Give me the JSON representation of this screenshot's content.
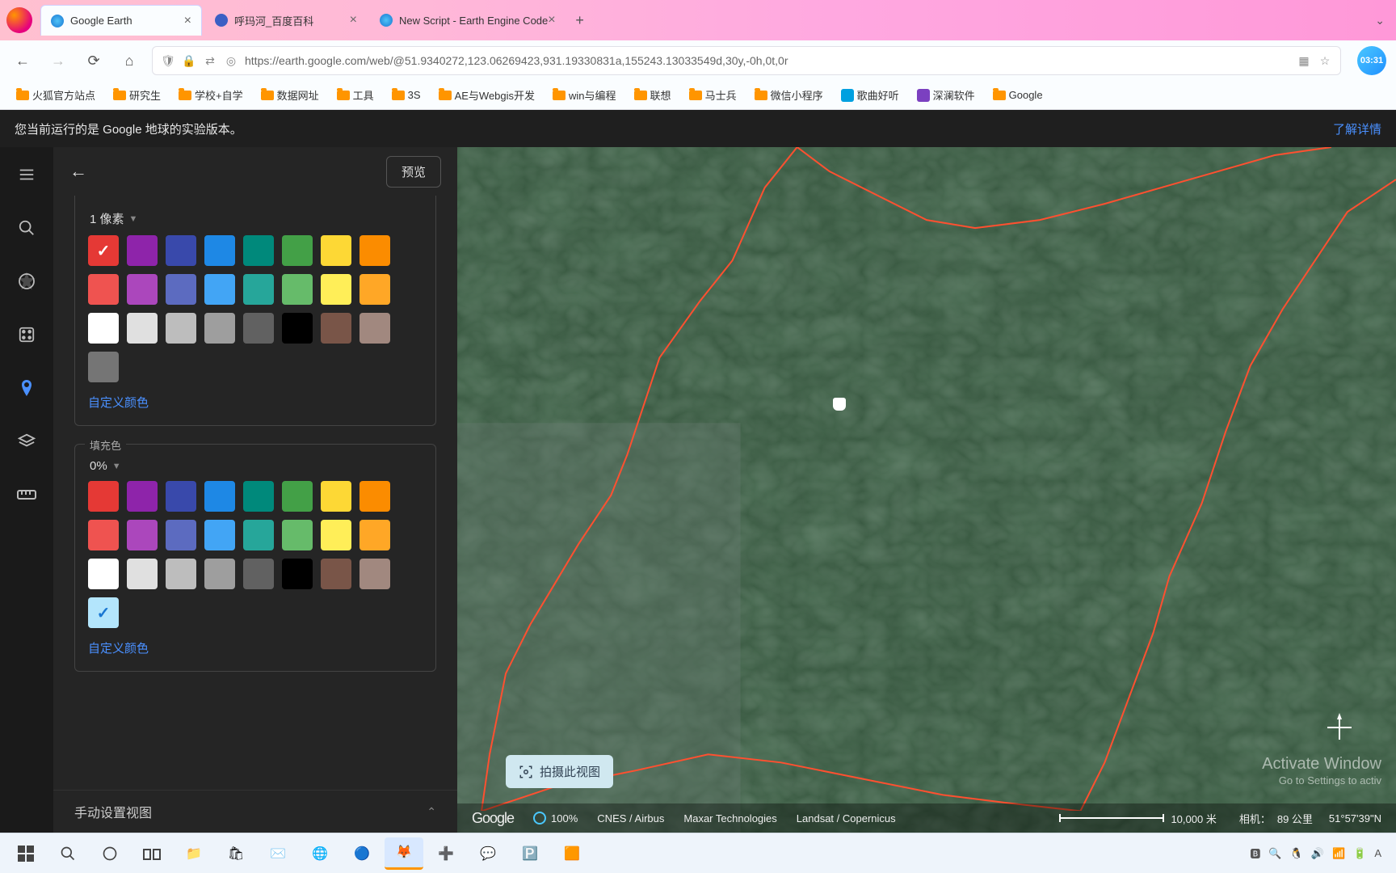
{
  "browser": {
    "tabs": [
      {
        "title": "Google Earth",
        "favicon": "#4285f4",
        "active": true
      },
      {
        "title": "呼玛河_百度百科",
        "favicon": "#3b5fc4",
        "active": false
      },
      {
        "title": "New Script - Earth Engine Code",
        "favicon": "#4285f4",
        "active": false
      }
    ],
    "url": "https://earth.google.com/web/@51.9340272,123.06269423,931.19330831a,155243.13033549d,30y,-0h,0t,0r",
    "clock": "03:31"
  },
  "bookmarks": [
    {
      "label": "火狐官方站点",
      "type": "folder"
    },
    {
      "label": "研究生",
      "type": "folder"
    },
    {
      "label": "学校+自学",
      "type": "folder"
    },
    {
      "label": "数据网址",
      "type": "folder"
    },
    {
      "label": "工具",
      "type": "folder"
    },
    {
      "label": "3S",
      "type": "folder"
    },
    {
      "label": "AE与Webgis开发",
      "type": "folder"
    },
    {
      "label": "win与编程",
      "type": "folder"
    },
    {
      "label": "联想",
      "type": "folder"
    },
    {
      "label": "马士兵",
      "type": "folder"
    },
    {
      "label": "微信小程序",
      "type": "folder"
    },
    {
      "label": "歌曲好听",
      "type": "icon",
      "color": "#00a0e0"
    },
    {
      "label": "深澜软件",
      "type": "icon",
      "color": "#7b40c0"
    },
    {
      "label": "Google",
      "type": "folder"
    }
  ],
  "banner": {
    "text": "您当前运行的是 Google 地球的实验版本。",
    "link": "了解详情"
  },
  "panel": {
    "preview": "预览",
    "stroke_width": "1 像素",
    "fill_label": "填充色",
    "fill_opacity": "0%",
    "custom_color": "自定义颜色",
    "manual_view": "手动设置视图"
  },
  "palette1": {
    "selected": 0,
    "colors": [
      "#e53935",
      "#8e24aa",
      "#3949ab",
      "#1e88e5",
      "#00897b",
      "#43a047",
      "#fdd835",
      "#fb8c00",
      "#ef5350",
      "#ab47bc",
      "#5c6bc0",
      "#42a5f5",
      "#26a69a",
      "#66bb6a",
      "#ffee58",
      "#ffa726",
      "#ffffff",
      "#e0e0e0",
      "#bdbdbd",
      "#9e9e9e",
      "#616161",
      "#000000",
      "#795548",
      "#a1887f",
      "#757575"
    ]
  },
  "palette2": {
    "selected": 24,
    "colors": [
      "#e53935",
      "#8e24aa",
      "#3949ab",
      "#1e88e5",
      "#00897b",
      "#43a047",
      "#fdd835",
      "#fb8c00",
      "#ef5350",
      "#ab47bc",
      "#5c6bc0",
      "#42a5f5",
      "#26a69a",
      "#66bb6a",
      "#ffee58",
      "#ffa726",
      "#ffffff",
      "#e0e0e0",
      "#bdbdbd",
      "#9e9e9e",
      "#616161",
      "#000000",
      "#795548",
      "#a1887f",
      "#b3e5fc"
    ]
  },
  "map": {
    "capture": "拍摄此视图",
    "logo": "Google",
    "load_pct": "100%",
    "attrib1": "CNES / Airbus",
    "attrib2": "Maxar Technologies",
    "attrib3": "Landsat / Copernicus",
    "scale": "10,000 米",
    "camera_label": "相机：",
    "camera_alt": "89 公里",
    "coords": "51°57'39\"N",
    "watermark1": "Activate Window",
    "watermark2": "Go to Settings to activ"
  },
  "taskbar": {
    "tray": [
      "🅱",
      "🔍",
      "🐧",
      "🔊",
      "📶",
      "🔋",
      "A"
    ]
  }
}
